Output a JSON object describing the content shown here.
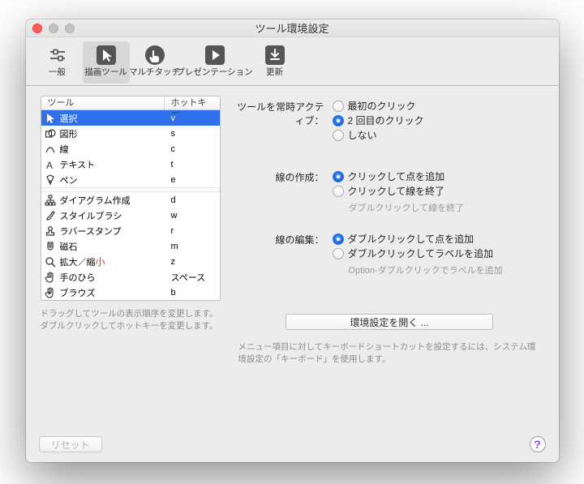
{
  "title": "ツール環境設定",
  "toolbar": {
    "tabs": [
      {
        "label": "一般"
      },
      {
        "label": "描画ツール"
      },
      {
        "label": "マルチタッチ"
      },
      {
        "label": "プレゼンテーション"
      },
      {
        "label": "更新"
      }
    ]
  },
  "list": {
    "head_tool": "ツール",
    "head_hotkey": "ホットキー",
    "items": [
      {
        "name": "選択",
        "hot": "v"
      },
      {
        "name": "図形",
        "hot": "s"
      },
      {
        "name": "線",
        "hot": "c"
      },
      {
        "name": "テキスト",
        "hot": "t"
      },
      {
        "name": "ペン",
        "hot": "e"
      },
      {
        "sep": true
      },
      {
        "name": "ダイアグラム作成",
        "hot": "d"
      },
      {
        "name": "スタイルブラシ",
        "hot": "w"
      },
      {
        "name": "ラバースタンプ",
        "hot": "r"
      },
      {
        "name": "磁石",
        "hot": "m"
      },
      {
        "name": "拡大／縮小",
        "hot": "z"
      },
      {
        "name": "手のひら",
        "hot": "スペース"
      },
      {
        "name": "ブラウズ",
        "hot": "b"
      }
    ],
    "hint": "ドラッグしてツールの表示順序を変更します。ダブルクリックしてホットキーを変更します。"
  },
  "right": {
    "active_label": "ツールを常時アクティブ：",
    "active_opts": [
      "最初のクリック",
      "2 回目のクリック",
      "しない"
    ],
    "create_label": "線の作成：",
    "create_opts": [
      "クリックして点を追加",
      "クリックして線を終了"
    ],
    "create_hint": "ダブルクリックして線を終了",
    "edit_label": "線の編集：",
    "edit_opts": [
      "ダブルクリックして点を追加",
      "ダブルクリックしてラベルを追加"
    ],
    "edit_hint": "Option-ダブルクリックでラベルを追加",
    "open_prefs": "環境設定を開く ...",
    "hint": "メニュー項目に対してキーボードショートカットを設定するには、システム環境設定の「キーボード」を使用します。"
  },
  "footer": {
    "reset": "リセット"
  },
  "shrink_char": "小"
}
